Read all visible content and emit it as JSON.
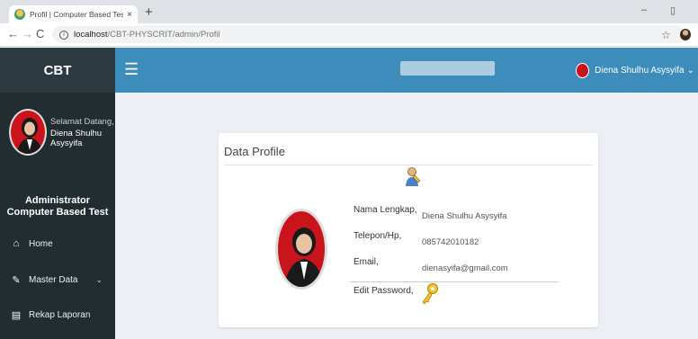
{
  "browser": {
    "tab_title": "Profil | Computer Based Test (CBT",
    "tab_close": "×",
    "new_tab": "+",
    "url_host": "localhost",
    "url_path": "/CBT-PHYSCRIT/admin/Profil",
    "minimize": "–",
    "restore": "▯"
  },
  "sidebar": {
    "brand": "CBT",
    "welcome": "Selamat Datang,",
    "user_name": "Diena Shulhu Asysyifa",
    "role_line1": "Administrator",
    "role_line2": "Computer Based Test",
    "menu": [
      {
        "label": "Home",
        "icon": "home-icon"
      },
      {
        "label": "Master Data",
        "icon": "edit-icon"
      },
      {
        "label": "Rekap Laporan",
        "icon": "document-icon"
      }
    ]
  },
  "topbar": {
    "user_name": "Diena Shulhu Asysyifa",
    "caret": "⌄"
  },
  "profile": {
    "title": "Data Profile",
    "fields": [
      {
        "label": "Nama Lengkap,",
        "value": "Diena Shulhu Asysyifa"
      },
      {
        "label": "Telepon/Hp,",
        "value": "085742010182"
      },
      {
        "label": "Email,",
        "value": "dienasyifa@gmail.com"
      },
      {
        "label": "Edit Password,",
        "value": ""
      }
    ]
  },
  "colors": {
    "sidebar_bg": "#222d32",
    "topbar_bg": "#3c8dbc",
    "content_bg": "#ecf0f5",
    "avatar_bg": "#c9141b"
  }
}
